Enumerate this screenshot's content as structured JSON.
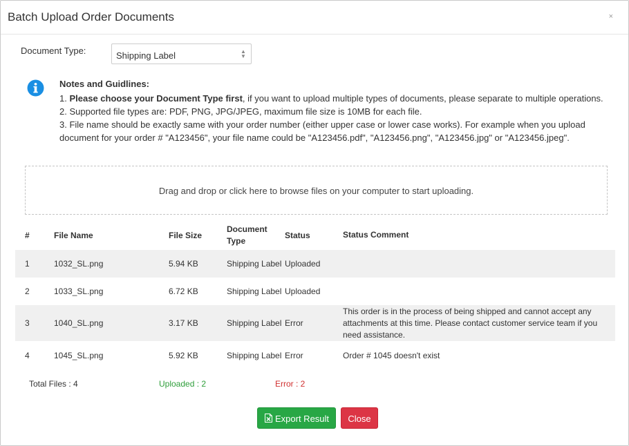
{
  "modal": {
    "title": "Batch Upload Order Documents",
    "close_glyph": "×"
  },
  "document_type": {
    "label": "Document Type:",
    "selected": "Shipping Label",
    "arrows": "▲▼"
  },
  "notes": {
    "icon": "info-circle-icon",
    "title": "Notes and Guidlines:",
    "items": [
      {
        "prefix": "1. ",
        "bold": "Please choose your Document Type first",
        "text": ", if you want to upload multiple types of documents, please separate to multiple operations."
      },
      {
        "text": "2.  Supported file types are: PDF, PNG, JPG/JPEG, maximum file size is 10MB for each file."
      },
      {
        "text": "3.  File name should be exactly same with your order number (either upper case or lower case works). For example when you upload document for your order # \"A123456\", your file name could be \"A123456.pdf\", \"A123456.png\", \"A123456.jpg\" or \"A123456.jpeg\"."
      }
    ]
  },
  "dropzone": {
    "text": "Drag and drop or click here to browse files on your computer to start uploading."
  },
  "table": {
    "headers": [
      "#",
      "File Name",
      "File Size",
      "Document Type",
      "Status",
      "Status Comment"
    ],
    "rows": [
      {
        "idx": "1",
        "name": "1032_SL.png",
        "size": "5.94 KB",
        "type": "Shipping Label",
        "status": "Uploaded",
        "comment": ""
      },
      {
        "idx": "2",
        "name": "1033_SL.png",
        "size": "6.72 KB",
        "type": "Shipping Label",
        "status": "Uploaded",
        "comment": ""
      },
      {
        "idx": "3",
        "name": "1040_SL.png",
        "size": "3.17 KB",
        "type": "Shipping Label",
        "status": "Error",
        "comment": "This order is in the process of being shipped and cannot accept any attachments at this time. Please contact customer service team if you need assistance."
      },
      {
        "idx": "4",
        "name": "1045_SL.png",
        "size": "5.92 KB",
        "type": "Shipping Label",
        "status": "Error",
        "comment": "Order # 1045 doesn't exist"
      }
    ]
  },
  "summary": {
    "total": "Total Files : 4",
    "uploaded": "Uploaded : 2",
    "error": "Error : 2"
  },
  "buttons": {
    "export_label": "Export Result",
    "export_icon": "excel-export-icon",
    "close_label": "Close"
  },
  "colors": {
    "success": "#28a745",
    "danger": "#dc3545",
    "info": "#1a8fe3",
    "uploaded_text": "#2e9e3a",
    "error_text": "#d02f2f"
  }
}
